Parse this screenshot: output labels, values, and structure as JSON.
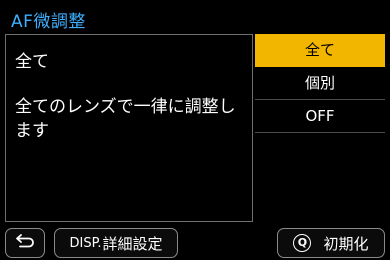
{
  "header": {
    "title": "AF微調整"
  },
  "description": {
    "heading": "全て",
    "body": "全てのレンズで一律に調整します"
  },
  "options": [
    {
      "label": "全て",
      "selected": true
    },
    {
      "label": "個別",
      "selected": false
    },
    {
      "label": "OFF",
      "selected": false
    }
  ],
  "footer": {
    "back_icon": "return-arrow-icon",
    "disp_key": "DISP.",
    "disp_label": "詳細設定",
    "reset_icon": "q-button-icon",
    "reset_icon_glyph": "Q",
    "reset_label": "初期化"
  },
  "colors": {
    "title": "#3fb0ff",
    "selected_bg": "#f2b600"
  }
}
